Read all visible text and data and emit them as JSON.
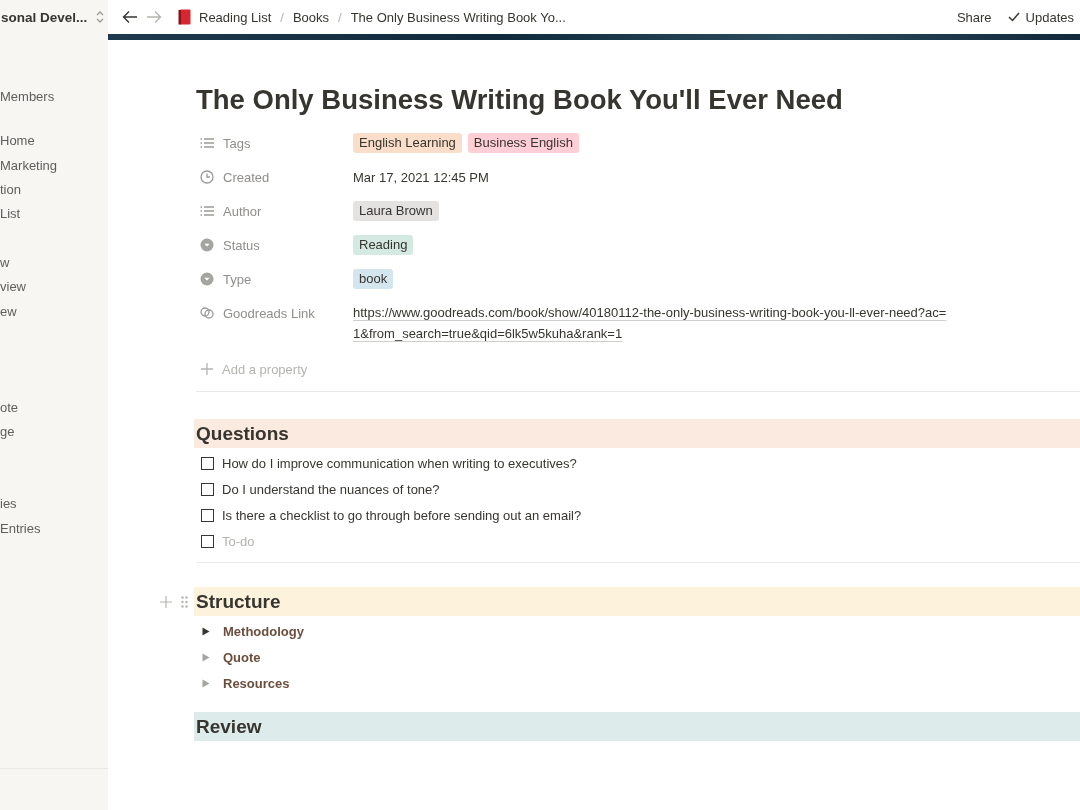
{
  "sidebar": {
    "workspace": "sonal Devel...",
    "items": [
      "Members",
      "Home",
      "Marketing",
      "tion",
      "List",
      "w",
      "view",
      "ew",
      "ote",
      "ge",
      "ies",
      "Entries"
    ]
  },
  "breadcrumbs": [
    "Reading List",
    "Books",
    "The Only Business Writing Book Yo..."
  ],
  "breadcrumb_separators": [
    "/",
    "/"
  ],
  "topbar_actions": {
    "share": "Share",
    "updates": "Updates"
  },
  "page": {
    "title": "The Only Business Writing Book You'll Ever Need",
    "properties": [
      {
        "kind": "multi",
        "name": "Tags",
        "tags": [
          {
            "label": "English Learning",
            "color": "#fadec9"
          },
          {
            "label": "Business English",
            "color": "#ffcfd5"
          }
        ]
      },
      {
        "kind": "date",
        "name": "Created",
        "value": "Mar 17, 2021 12:45 PM"
      },
      {
        "kind": "multi",
        "name": "Author",
        "tags": [
          {
            "label": "Laura Brown",
            "color": "#e3e2e0"
          }
        ]
      },
      {
        "kind": "select",
        "name": "Status",
        "tags": [
          {
            "label": "Reading",
            "color": "#d3e9e1"
          }
        ]
      },
      {
        "kind": "select",
        "name": "Type",
        "tags": [
          {
            "label": "book",
            "color": "#d3e5ef"
          }
        ]
      },
      {
        "kind": "url",
        "name": "Goodreads Link",
        "value": "https://www.goodreads.com/book/show/40180112-the-only-business-writing-book-you-ll-ever-need?ac=1&from_search=true&qid=6lk5w5kuha&rank=1"
      }
    ],
    "add_property": "Add a property",
    "sections": [
      {
        "heading": "Questions",
        "color": "#fbeadf",
        "todos": [
          {
            "text": "How do I improve communication when writing to executives?",
            "checked": false
          },
          {
            "text": "Do I understand the nuances of tone?",
            "checked": false
          },
          {
            "text": "Is there a checklist to go through before sending out an email?",
            "checked": false
          }
        ],
        "todo_placeholder": {
          "text": "To-do",
          "checked": false
        }
      },
      {
        "heading": "Structure",
        "color": "#fdf3dd",
        "toggles": [
          {
            "label": "Methodology",
            "empty": false
          },
          {
            "label": "Quote",
            "empty": true
          },
          {
            "label": "Resources",
            "empty": true
          }
        ]
      },
      {
        "heading": "Review",
        "color": "#ddebea"
      }
    ]
  }
}
